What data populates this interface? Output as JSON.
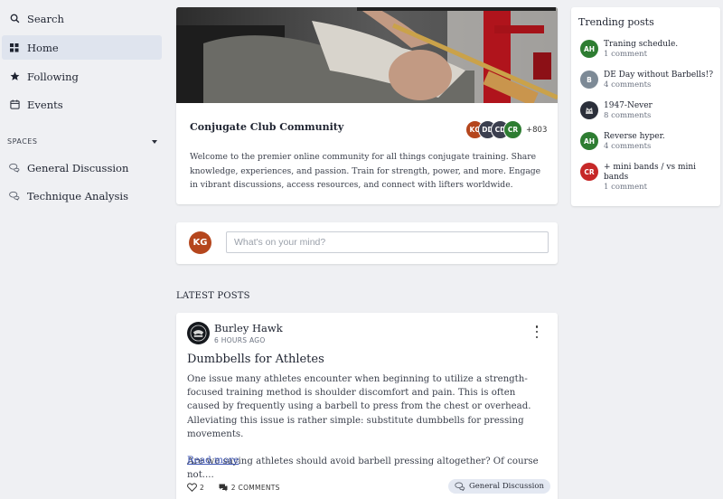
{
  "sidebar": {
    "items": [
      {
        "label": "Search",
        "icon": "search-icon"
      },
      {
        "label": "Home",
        "icon": "grid-icon",
        "active": true
      },
      {
        "label": "Following",
        "icon": "star-icon"
      },
      {
        "label": "Events",
        "icon": "calendar-icon"
      }
    ],
    "spaces_heading": "SPACES",
    "spaces": [
      {
        "label": "General Discussion",
        "icon": "chat-bubbles-icon"
      },
      {
        "label": "Technique Analysis",
        "icon": "chat-bubbles-icon"
      }
    ]
  },
  "community": {
    "name": "Conjugate Club Community",
    "members": [
      {
        "initials": "KG",
        "color": "#b5461d"
      },
      {
        "initials": "DD",
        "color": "#3b3f4f"
      },
      {
        "initials": "CD",
        "color": "#3b3f4f"
      },
      {
        "initials": "CR",
        "color": "#2e7d32"
      }
    ],
    "member_count": "+803",
    "description": "Welcome to the premier online community for all things conjugate training. Share knowledge, experiences, and passion. Train for strength, power, and more. Engage in vibrant discussions, access resources, and connect with lifters worldwide."
  },
  "composer": {
    "avatar_initials": "KG",
    "avatar_color": "#b5461d",
    "placeholder": "What's on your mind?"
  },
  "latest_posts_heading": "LATEST POSTS",
  "post": {
    "author": "Burley Hawk",
    "time": "6 HOURS AGO",
    "title": "Dumbbells for Athletes",
    "body": "One issue many athletes encounter when beginning to utilize a strength-focused training method is shoulder discomfort and pain. This is often caused by frequently using a barbell to press from the chest or overhead. Alleviating this issue is rather simple: substitute dumbbells for pressing movements.",
    "body2": "Are we saying athletes should avoid barbell pressing altogether? Of course not....",
    "read_more": "Read more",
    "likes": "2",
    "comments": "2 COMMENTS",
    "space": "General Discussion"
  },
  "trending": {
    "heading": "Trending posts",
    "items": [
      {
        "initials": "AH",
        "color": "#2e7d32",
        "title": "Traning schedule.",
        "comments": "1 comment"
      },
      {
        "initials": "B",
        "color": "#7d8a96",
        "title": "DE Day without Barbells!?",
        "comments": "4 comments"
      },
      {
        "initials": "",
        "color": "#2b2f3a",
        "title": "1947-Never",
        "comments": "8 comments"
      },
      {
        "initials": "AH",
        "color": "#2e7d32",
        "title": "Reverse hyper.",
        "comments": "4 comments"
      },
      {
        "initials": "CR",
        "color": "#c62828",
        "title": "+ mini bands / vs mini bands",
        "comments": "1 comment"
      }
    ]
  }
}
